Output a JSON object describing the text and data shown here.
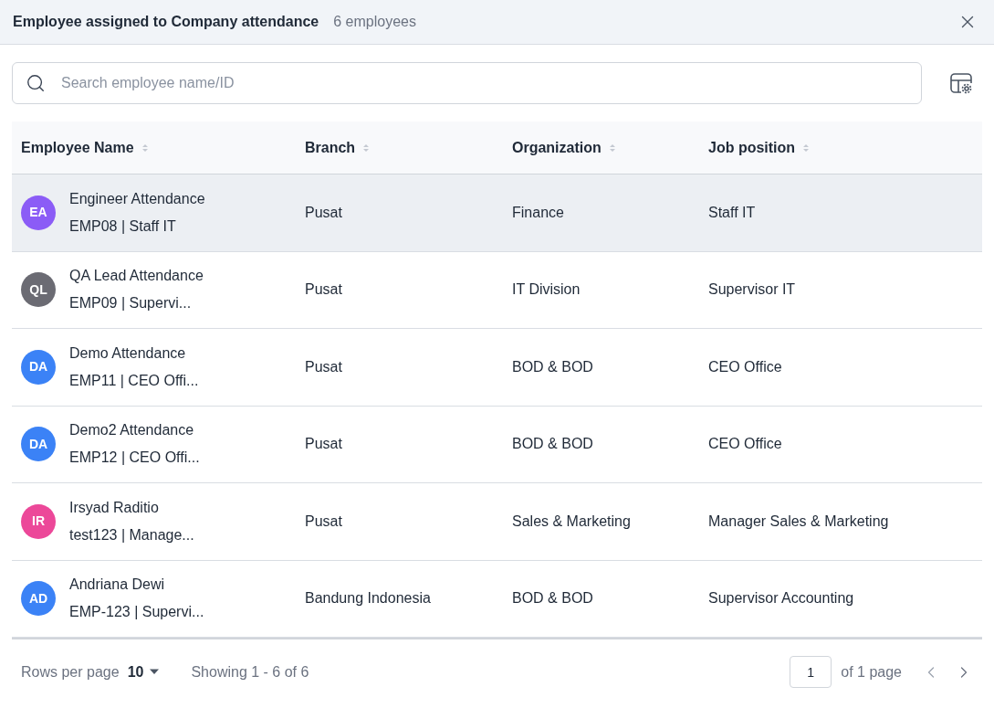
{
  "header": {
    "title": "Employee assigned to Company attendance",
    "count": "6 employees"
  },
  "search": {
    "placeholder": "Search employee name/ID"
  },
  "table": {
    "columns": [
      "Employee Name",
      "Branch",
      "Organization",
      "Job position"
    ],
    "rows": [
      {
        "initials": "EA",
        "color": "#8b5cf6",
        "name": "Engineer Attendance",
        "sub": "EMP08 | Staff IT",
        "branch": "Pusat",
        "organization": "Finance",
        "job": "Staff IT",
        "selected": true
      },
      {
        "initials": "QL",
        "color": "#6b6b73",
        "name": "QA Lead Attendance",
        "sub": "EMP09 | Supervi...",
        "branch": "Pusat",
        "organization": "IT Division",
        "job": "Supervisor IT",
        "selected": false
      },
      {
        "initials": "DA",
        "color": "#3b82f6",
        "name": "Demo Attendance",
        "sub": "EMP11 | CEO Offi...",
        "branch": "Pusat",
        "organization": "BOD & BOD",
        "job": "CEO Office",
        "selected": false
      },
      {
        "initials": "DA",
        "color": "#3b82f6",
        "name": "Demo2 Attendance",
        "sub": "EMP12 | CEO Offi...",
        "branch": "Pusat",
        "organization": "BOD & BOD",
        "job": "CEO Office",
        "selected": false
      },
      {
        "initials": "IR",
        "color": "#ec4899",
        "name": "Irsyad Raditio",
        "sub": "test123 | Manage...",
        "branch": "Pusat",
        "organization": "Sales & Marketing",
        "job": "Manager Sales & Marketing",
        "selected": false
      },
      {
        "initials": "AD",
        "color": "#3b82f6",
        "name": "Andriana Dewi",
        "sub": "EMP-123 | Supervi...",
        "branch": "Bandung Indonesia",
        "organization": "BOD & BOD",
        "job": "Supervisor Accounting",
        "selected": false
      }
    ]
  },
  "footer": {
    "rows_label": "Rows per page",
    "rows_value": "10",
    "showing": "Showing 1 - 6 of 6",
    "page": "1",
    "of_pages": "of 1 page"
  }
}
